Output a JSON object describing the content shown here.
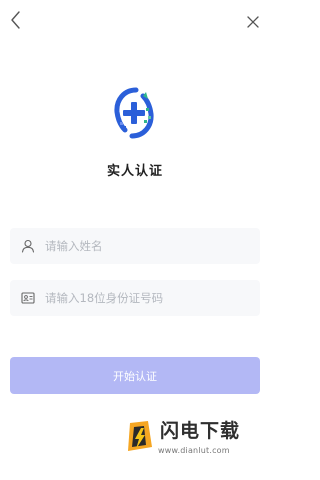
{
  "title": "实人认证",
  "name_field": {
    "placeholder": "请输入姓名",
    "value": ""
  },
  "id_field": {
    "placeholder": "请输入18位身份证号码",
    "value": ""
  },
  "start_button": {
    "label": "开始认证",
    "disabled": true
  },
  "watermark": {
    "brand": "闪电下载",
    "url": "www.dianlut.com"
  },
  "colors": {
    "button": "#b3b8f5",
    "logo_blue": "#2b5fd9",
    "logo_green": "#2fb58c",
    "field_bg": "#f7f8fa"
  },
  "icons": {
    "back": "chevron-left-icon",
    "close": "close-icon",
    "user": "user-icon",
    "id_card": "id-card-icon"
  }
}
